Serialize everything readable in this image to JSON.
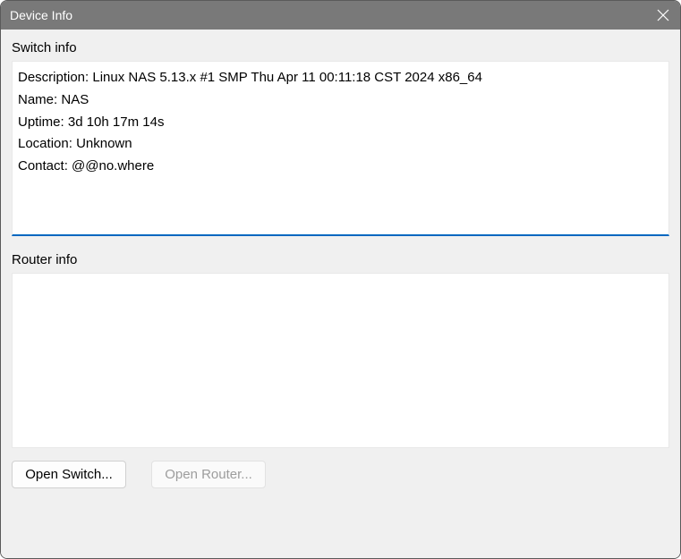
{
  "titlebar": {
    "title": "Device Info"
  },
  "switch": {
    "label": "Switch info",
    "description_label": "Description:",
    "description_value": "Linux NAS 5.13.x #1 SMP Thu Apr 11 00:11:18 CST 2024 x86_64",
    "name_label": "Name:",
    "name_value": "NAS",
    "uptime_label": "Uptime:",
    "uptime_value": "3d 10h 17m 14s",
    "location_label": "Location:",
    "location_value": "Unknown",
    "contact_label": "Contact:",
    "contact_value": "@@no.where"
  },
  "router": {
    "label": "Router info",
    "content": ""
  },
  "buttons": {
    "open_switch": "Open Switch...",
    "open_router": "Open Router..."
  }
}
